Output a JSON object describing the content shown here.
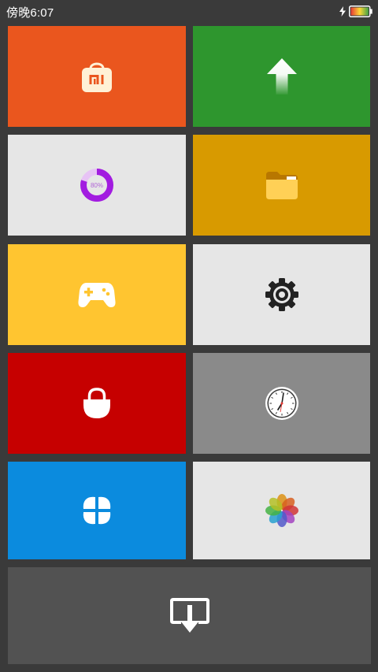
{
  "status_bar": {
    "time": "傍晚6:07",
    "charging_icon": "lightning-bolt-icon",
    "battery_icon": "battery-icon",
    "battery_colors": [
      "#e53935",
      "#fdd835",
      "#43a047"
    ]
  },
  "tiles": [
    {
      "icon": "mi-store-bag-icon",
      "color": "#ea561e"
    },
    {
      "icon": "upload-arrow-icon",
      "color": "#2e962e"
    },
    {
      "icon": "cleaner-ring-icon",
      "color": "#e6e6e6",
      "ring_label": "80%"
    },
    {
      "icon": "folder-icon",
      "color": "#d89a00"
    },
    {
      "icon": "gamepad-icon",
      "color": "#ffc530"
    },
    {
      "icon": "settings-gear-icon",
      "color": "#e6e6e6"
    },
    {
      "icon": "padlock-icon",
      "color": "#c60000"
    },
    {
      "icon": "clock-icon",
      "color": "#8a8a8a"
    },
    {
      "icon": "petal-windmill-icon",
      "color": "#0b8bde"
    },
    {
      "icon": "photos-flower-icon",
      "color": "#e6e6e6"
    },
    {
      "icon": "airplay-download-icon",
      "color": "#525252"
    }
  ],
  "cleaner": {
    "progress": 0.8
  }
}
